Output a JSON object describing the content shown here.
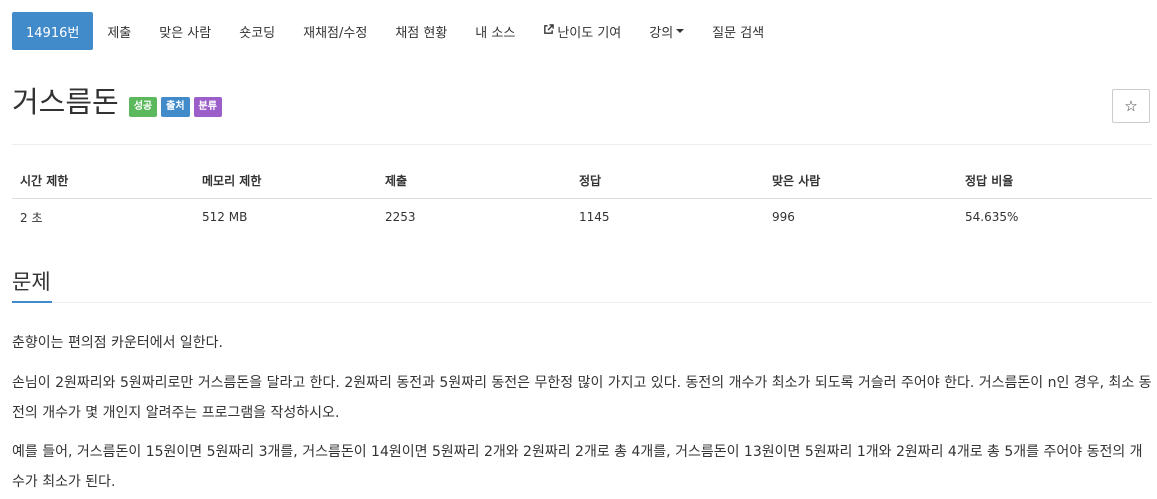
{
  "nav": {
    "tabs": [
      {
        "label": "14916번"
      },
      {
        "label": "제출"
      },
      {
        "label": "맞은 사람"
      },
      {
        "label": "숏코딩"
      },
      {
        "label": "재채점/수정"
      },
      {
        "label": "채점 현황"
      },
      {
        "label": "내 소스"
      },
      {
        "label": "난이도 기여",
        "icon": "external-link-icon"
      },
      {
        "label": "강의",
        "icon": "caret-down-icon"
      },
      {
        "label": "질문 검색"
      }
    ]
  },
  "problem": {
    "title": "거스름돈",
    "labels": {
      "success": "성공",
      "source": "출처",
      "category": "분류"
    },
    "star_icon": "☆"
  },
  "info_table": {
    "headers": [
      "시간 제한",
      "메모리 제한",
      "제출",
      "정답",
      "맞은 사람",
      "정답 비율"
    ],
    "row": [
      "2 초",
      "512 MB",
      "2253",
      "1145",
      "996",
      "54.635%"
    ]
  },
  "section": {
    "title": "문제"
  },
  "description": [
    "춘향이는 편의점 카운터에서 일한다.",
    "손님이 2원짜리와 5원짜리로만 거스름돈을 달라고 한다. 2원짜리 동전과 5원짜리 동전은 무한정 많이 가지고 있다. 동전의 개수가 최소가 되도록 거슬러 주어야 한다. 거스름돈이 n인 경우, 최소 동전의 개수가 몇 개인지 알려주는 프로그램을 작성하시오.",
    "예를 들어, 거스름돈이 15원이면 5원짜리 3개를, 거스름돈이 14원이면 5원짜리 2개와 2원짜리 2개로 총 4개를, 거스름돈이 13원이면 5원짜리 1개와 2원짜리 4개로 총 5개를 주어야 동전의 개수가 최소가 된다."
  ],
  "colors": {
    "accent": "#428bca",
    "success": "#5cb85c",
    "purple": "#9c5fc9"
  }
}
